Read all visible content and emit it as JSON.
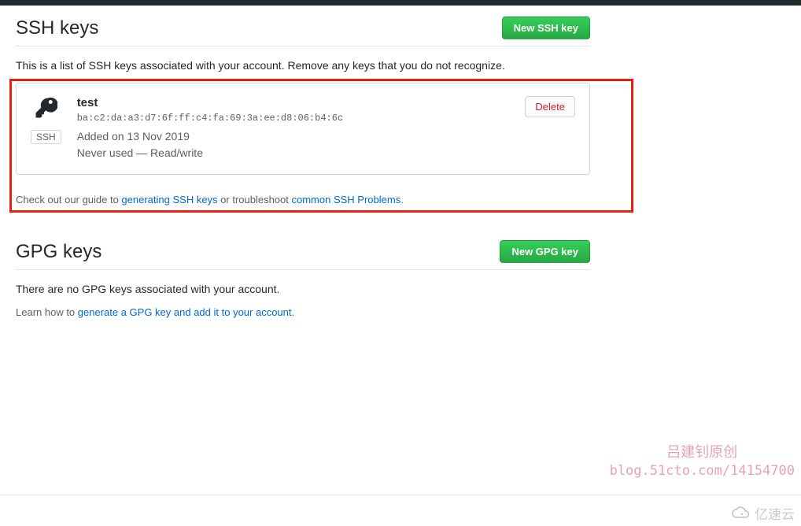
{
  "ssh": {
    "heading": "SSH keys",
    "new_button": "New SSH key",
    "description": "This is a list of SSH keys associated with your account. Remove any keys that you do not recognize.",
    "key": {
      "title": "test",
      "fingerprint": "ba:c2:da:a3:d7:6f:ff:c4:fa:69:3a:ee:d8:06:b4:6c",
      "added": "Added on 13 Nov 2019",
      "usage": "Never used — Read/write",
      "badge": "SSH",
      "delete": "Delete"
    },
    "guide_prefix": "Check out our guide to ",
    "guide_link1": "generating SSH keys",
    "guide_mid": " or troubleshoot ",
    "guide_link2": "common SSH Problems",
    "guide_suffix": "."
  },
  "gpg": {
    "heading": "GPG keys",
    "new_button": "New GPG key",
    "description": "There are no GPG keys associated with your account.",
    "learn_prefix": "Learn how to ",
    "learn_link": "generate a GPG key and add it to your account",
    "learn_suffix": "."
  },
  "watermark": {
    "line1": "吕建钊原创",
    "line2": "blog.51cto.com/14154700"
  },
  "brand": "亿速云"
}
